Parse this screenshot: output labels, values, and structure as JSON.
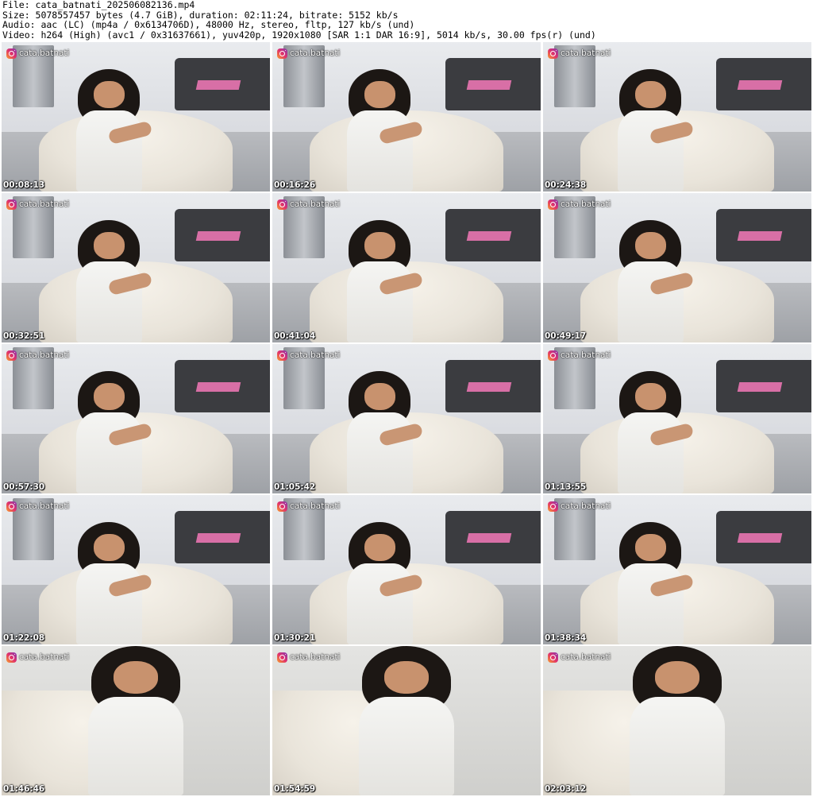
{
  "header": {
    "file_line": "File: cata_batnati_202506082136.mp4",
    "size_line": "Size: 5078557457 bytes (4.7 GiB), duration: 02:11:24, bitrate: 5152 kb/s",
    "audio_line": "Audio: aac (LC) (mp4a / 0x6134706D), 48000 Hz, stereo, fltp, 127 kb/s (und)",
    "video_line": "Video: h264 (High) (avc1 / 0x31637661), yuv420p, 1920x1080 [SAR 1:1 DAR 16:9], 5014 kb/s, 30.00 fps(r) (und)"
  },
  "watermark": {
    "handle": "cata.batnati",
    "icon": "instagram-icon"
  },
  "thumbnails": [
    {
      "timestamp": "00:08:13"
    },
    {
      "timestamp": "00:16:26"
    },
    {
      "timestamp": "00:24:38"
    },
    {
      "timestamp": "00:32:51"
    },
    {
      "timestamp": "00:41:04"
    },
    {
      "timestamp": "00:49:17"
    },
    {
      "timestamp": "00:57:30"
    },
    {
      "timestamp": "01:05:42"
    },
    {
      "timestamp": "01:13:55"
    },
    {
      "timestamp": "01:22:08"
    },
    {
      "timestamp": "01:30:21"
    },
    {
      "timestamp": "01:38:34"
    },
    {
      "timestamp": "01:46:46"
    },
    {
      "timestamp": "01:54:59"
    },
    {
      "timestamp": "02:03:12"
    }
  ],
  "colors": {
    "background": "#ffffff",
    "text": "#000000",
    "overlay_text": "#ffffff"
  }
}
